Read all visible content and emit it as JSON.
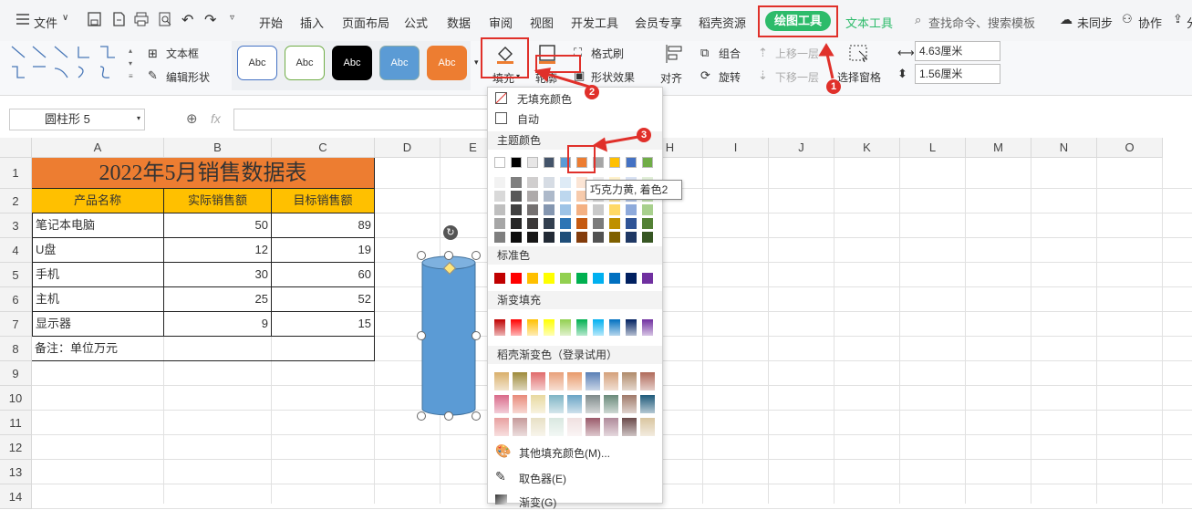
{
  "menu": {
    "file": "文件",
    "tabs": [
      "开始",
      "插入",
      "页面布局",
      "公式",
      "数据",
      "审阅",
      "视图",
      "开发工具",
      "会员专享",
      "稻壳资源"
    ],
    "active_tab": "绘图工具",
    "text_tools": "文本工具",
    "search": "查找命令、搜索模板",
    "sync": "未同步",
    "collab": "协作",
    "share": "分享"
  },
  "ribbon": {
    "text_box": "文本框",
    "edit_shape": "编辑形状",
    "style_label": "Abc",
    "fill": "填充",
    "outline": "轮廓",
    "format_painter": "格式刷",
    "shape_effect": "形状效果",
    "align": "对齐",
    "group": "组合",
    "rotate": "旋转",
    "bring_forward": "上移一层",
    "send_backward": "下移一层",
    "selection_pane": "选择窗格",
    "width": "4.63厘米",
    "height": "1.56厘米"
  },
  "formula_bar": {
    "name_box": "圆柱形 5",
    "fx": "fx"
  },
  "columns": [
    "A",
    "B",
    "C",
    "D",
    "E",
    "F",
    "G",
    "H",
    "I",
    "J",
    "K",
    "L",
    "M",
    "N",
    "O"
  ],
  "rows": [
    "1",
    "2",
    "3",
    "4",
    "5",
    "6",
    "7",
    "8",
    "9",
    "10",
    "11",
    "12",
    "13",
    "14"
  ],
  "sheet": {
    "title": "2022年5月销售数据表",
    "headers": [
      "产品名称",
      "实际销售额",
      "目标销售额"
    ],
    "data": [
      [
        "笔记本电脑",
        "50",
        "89"
      ],
      [
        "U盘",
        "12",
        "19"
      ],
      [
        "手机",
        "30",
        "60"
      ],
      [
        "主机",
        "25",
        "52"
      ],
      [
        "显示器",
        "9",
        "15"
      ]
    ],
    "note": "备注：单位万元"
  },
  "dropdown": {
    "no_fill": "无填充颜色",
    "auto": "自动",
    "theme_colors": "主题颜色",
    "tooltip": "巧克力黄, 着色2",
    "standard": "标准色",
    "gradient": "渐变填充",
    "docer_gradient": "稻壳渐变色（登录试用）",
    "more": "其他填充颜色(M)...",
    "picker": "取色器(E)",
    "gradient_item": "渐变(G)"
  },
  "badges": [
    "1",
    "2",
    "3"
  ],
  "colors": {
    "accent_green": "#2dbb6a",
    "title_orange": "#ed7d31",
    "header_yellow": "#ffc000",
    "shape_blue": "#5b9bd5",
    "annotation_red": "#e0302a"
  }
}
